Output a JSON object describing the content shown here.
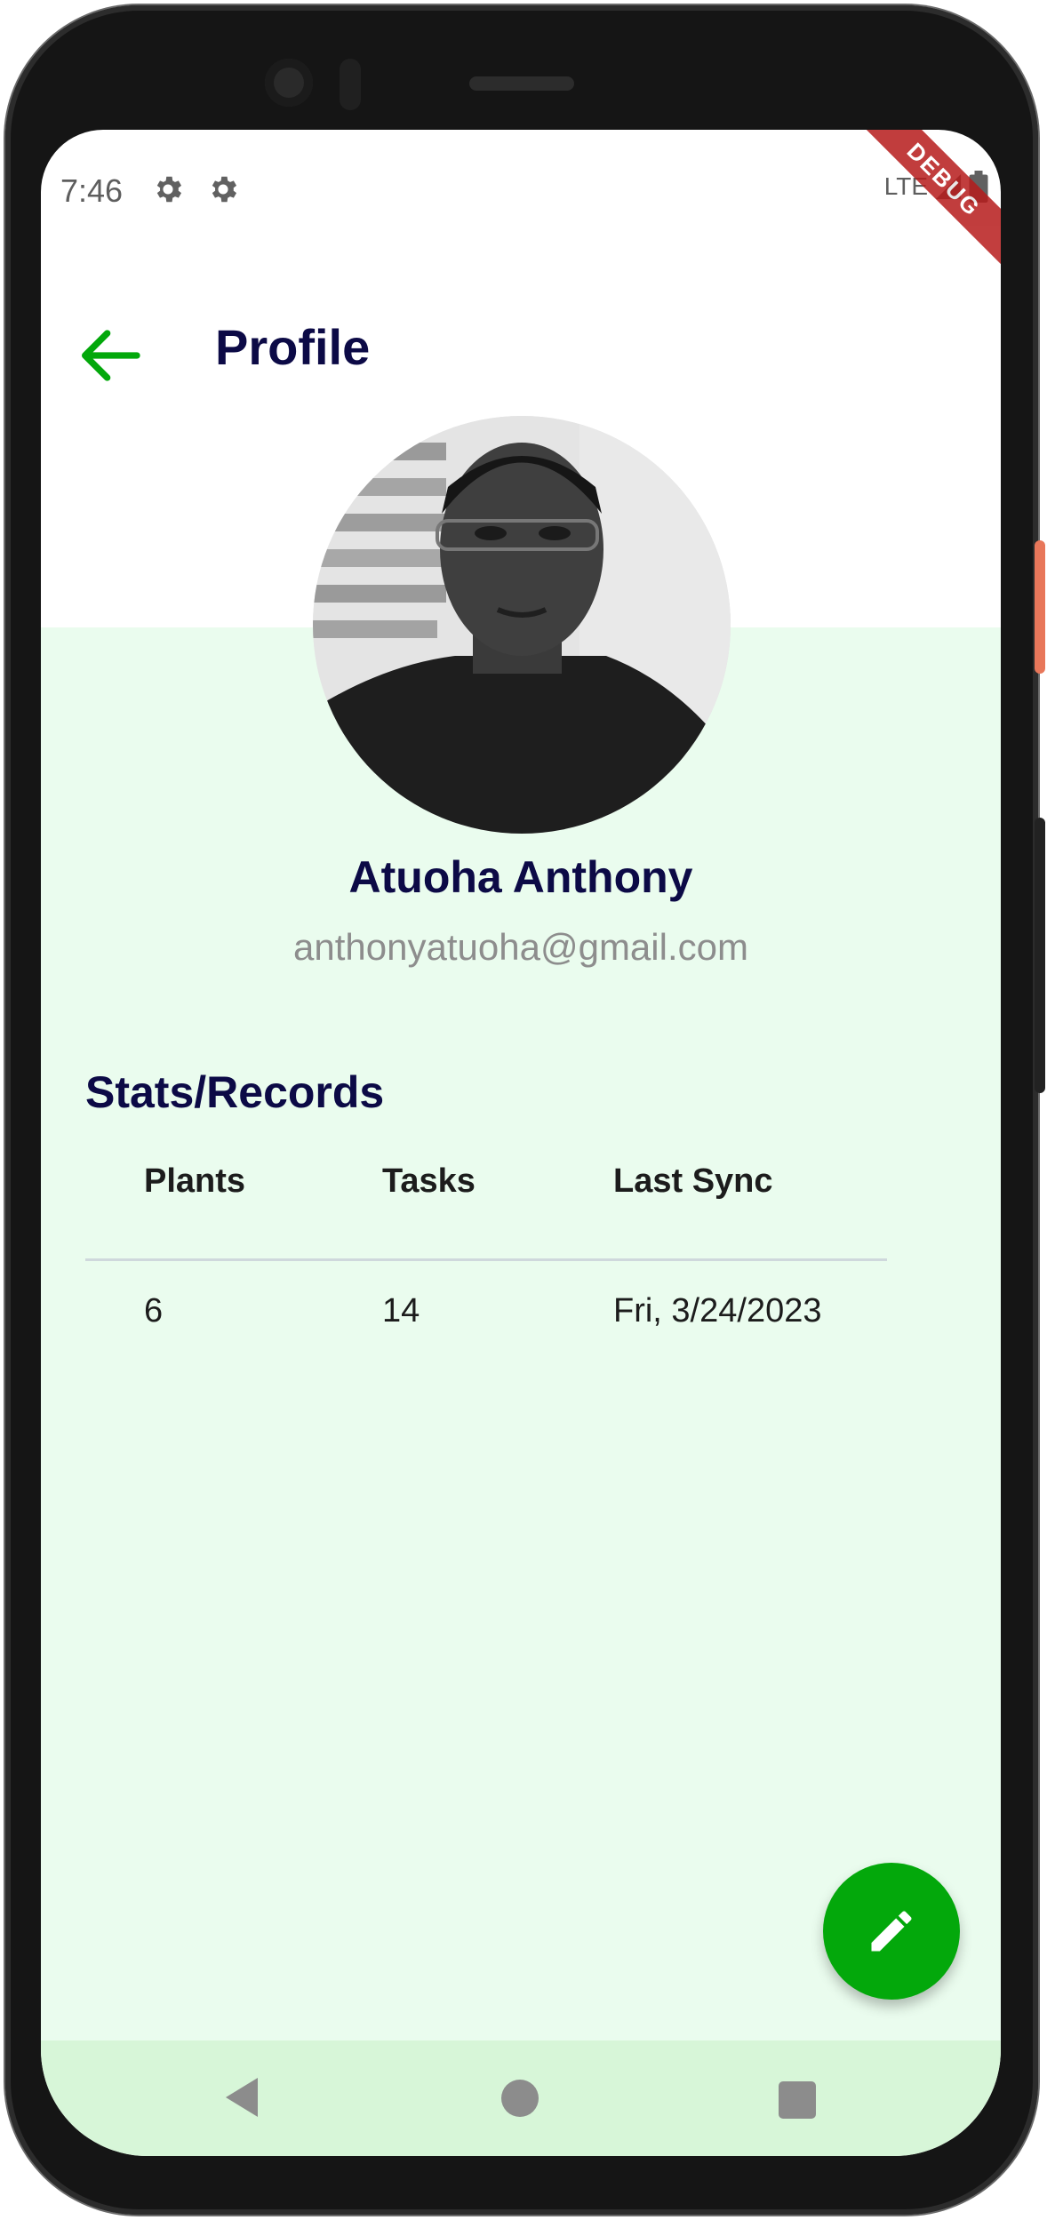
{
  "status_bar": {
    "time": "7:46",
    "network": "LTE",
    "debug_label": "DEBUG",
    "icons": [
      "settings-icon",
      "settings-icon",
      "signal-icon",
      "battery-icon"
    ]
  },
  "app_bar": {
    "title": "Profile",
    "back_icon": "arrow-left-icon"
  },
  "profile": {
    "name": "Atuoha Anthony",
    "email": "anthonyatuoha@gmail.com"
  },
  "stats": {
    "section_title": "Stats/Records",
    "columns": [
      "Plants",
      "Tasks",
      "Last Sync"
    ],
    "rows": [
      [
        "6",
        "14",
        "Fri, 3/24/2023"
      ]
    ]
  },
  "fab": {
    "icon": "pencil-edit-icon"
  },
  "nav_bar": {
    "icons": [
      "back-triangle-icon",
      "home-circle-icon",
      "recents-square-icon"
    ]
  },
  "colors": {
    "accent": "#03a80b",
    "title_text": "#0c0a46",
    "content_bg": "#eafcee",
    "nav_bg": "#d7f6d8",
    "debug_banner": "#b71c1c"
  }
}
